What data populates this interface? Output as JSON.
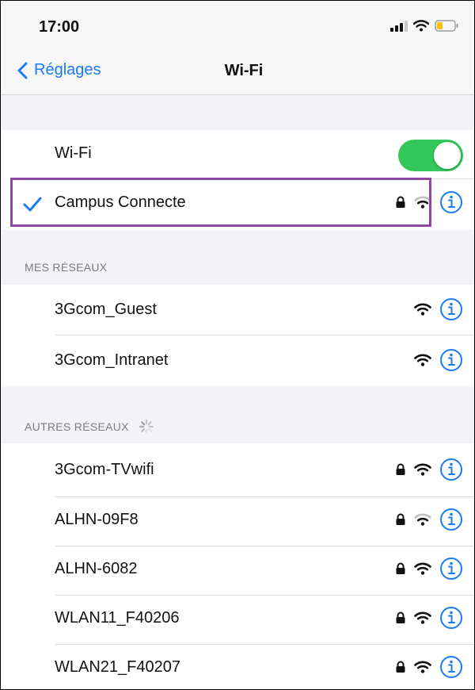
{
  "status_bar": {
    "time": "17:00",
    "icons": [
      "signal-icon",
      "wifi-icon",
      "battery-icon"
    ],
    "battery_color": "#f5c400"
  },
  "nav": {
    "back_label": "Réglages",
    "title": "Wi-Fi"
  },
  "wifi_toggle": {
    "label": "Wi-Fi",
    "state": "on",
    "color": "#34c759"
  },
  "connected_network": {
    "name": "Campus Connecte",
    "secured": true,
    "signal": "weak",
    "connected": true
  },
  "sections": {
    "my_networks": "MES RÉSEAUX",
    "other_networks": "AUTRES RÉSEAUX"
  },
  "my_networks": [
    {
      "name": "3Gcom_Guest",
      "secured": false,
      "signal": "full"
    },
    {
      "name": "3Gcom_Intranet",
      "secured": false,
      "signal": "full"
    }
  ],
  "other_networks": [
    {
      "name": "3Gcom-TVwifi",
      "secured": true,
      "signal": "full"
    },
    {
      "name": "ALHN-09F8",
      "secured": true,
      "signal": "weak"
    },
    {
      "name": "ALHN-6082",
      "secured": true,
      "signal": "full"
    },
    {
      "name": "WLAN11_F40206",
      "secured": true,
      "signal": "full"
    },
    {
      "name": "WLAN21_F40207",
      "secured": true,
      "signal": "full"
    }
  ],
  "colors": {
    "accent": "#1a7cf5",
    "highlight": "#8e4aa3",
    "toggle_on": "#34c759",
    "background": "#f2f2f7"
  }
}
